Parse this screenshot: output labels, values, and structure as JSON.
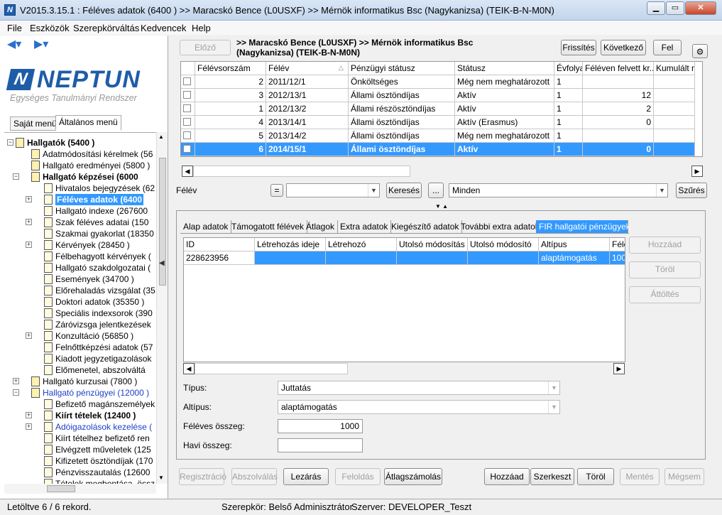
{
  "window": {
    "title": "V2015.3.15.1 : Féléves adatok (6400  )  >> Maracskó Bence (L0USXF) >> Mérnök informatikus Bsc (Nagykanizsa) (TEIK-B-N-M0N)"
  },
  "menu": [
    "File",
    "Eszközök",
    "Szerepkörváltás",
    "Kedvencek",
    "Help"
  ],
  "logo": {
    "name": "NEPTUN",
    "tagline": "Egységes Tanulmányi Rendszer"
  },
  "left_tabs": [
    "Saját menü",
    "Általános menü"
  ],
  "tree": [
    {
      "label": "Hallgatók (5400  )",
      "level": 0,
      "bold": true,
      "pm": "-"
    },
    {
      "label": "Adatmódosítási kérelmek (56",
      "level": 1
    },
    {
      "label": "Hallgató eredményei (5800  )",
      "level": 1
    },
    {
      "label": "Hallgató képzései (6000",
      "level": 1,
      "bold": true,
      "pm": "-"
    },
    {
      "label": "Hivatalos bejegyzések (62",
      "level": 2
    },
    {
      "label": "Féléves adatok (6400",
      "level": 2,
      "sel": true,
      "pm": "+"
    },
    {
      "label": "Hallgató indexe (267600",
      "level": 2
    },
    {
      "label": "Szak féléves adatai (150",
      "level": 2,
      "pm": "+"
    },
    {
      "label": "Szakmai gyakorlat (18350",
      "level": 2
    },
    {
      "label": "Kérvények (28450  )",
      "level": 2,
      "pm": "+"
    },
    {
      "label": "Félbehagyott kérvények (",
      "level": 2
    },
    {
      "label": "Hallgató szakdolgozatai (",
      "level": 2
    },
    {
      "label": "Események (34700  )",
      "level": 2
    },
    {
      "label": "Előrehaladás vizsgálat (35",
      "level": 2
    },
    {
      "label": "Doktori adatok (35350  )",
      "level": 2
    },
    {
      "label": "Speciális indexsorok (390",
      "level": 2
    },
    {
      "label": "Záróvizsga jelentkezések",
      "level": 2
    },
    {
      "label": "Konzultáció (56850  )",
      "level": 2,
      "pm": "+"
    },
    {
      "label": "Felnőttképzési adatok (57",
      "level": 2
    },
    {
      "label": "Kiadott jegyzetigazolások",
      "level": 2
    },
    {
      "label": "Előmenetel, abszolváltá",
      "level": 2
    },
    {
      "label": "Hallgató kurzusai (7800  )",
      "level": 1,
      "pm": "+"
    },
    {
      "label": "Hallgató pénzügyei (12000  )",
      "level": 1,
      "blue": true,
      "pm": "-"
    },
    {
      "label": "Befizető magánszemélyek",
      "level": 2
    },
    {
      "label": "Kiírt tételek (12400  )",
      "level": 2,
      "bold": true,
      "pm": "+"
    },
    {
      "label": "Adóigazolások kezelése (",
      "level": 2,
      "blue": true,
      "pm": "+"
    },
    {
      "label": "Kiírt tételhez befizető ren",
      "level": 2
    },
    {
      "label": "Elvégzett műveletek (125",
      "level": 2
    },
    {
      "label": "Kifizetett ösztöndíjak (170",
      "level": 2
    },
    {
      "label": "Pénzvisszautalás (12600",
      "level": 2
    },
    {
      "label": "Tételek megbontása, össz",
      "level": 2
    }
  ],
  "top_buttons": {
    "prev": "Előző",
    "refresh": "Frissítés",
    "next": "Következő",
    "up": "Fel"
  },
  "breadcrumb": ">> Maracskó Bence (L0USXF) >> Mérnök informatikus Bsc\n(Nagykanizsa) (TEIK-B-N-M0N)",
  "semester_grid": {
    "columns": [
      "Félévsorszám",
      "Félév",
      "Pénzügyi státusz",
      "Státusz",
      "Évfolyam",
      "Féléven felvett kr...",
      "Kumulált me"
    ],
    "rows": [
      [
        "2",
        "2011/12/1",
        "Önköltséges",
        "Még nem meghatározott",
        "1",
        "",
        ""
      ],
      [
        "3",
        "2012/13/1",
        "Állami ösztöndíjas",
        "Aktív",
        "1",
        "12",
        ""
      ],
      [
        "1",
        "2012/13/2",
        "Állami részösztöndíjas",
        "Aktív",
        "1",
        "2",
        ""
      ],
      [
        "4",
        "2013/14/1",
        "Állami ösztöndíjas",
        "Aktív (Erasmus)",
        "1",
        "0",
        ""
      ],
      [
        "5",
        "2013/14/2",
        "Állami ösztöndíjas",
        "Még nem meghatározott",
        "1",
        "",
        ""
      ],
      [
        "6",
        "2014/15/1",
        "Állami ösztöndíjas",
        "Aktív",
        "1",
        "0",
        ""
      ]
    ],
    "selected_row": 5
  },
  "filter": {
    "label": "Félév",
    "op": "=",
    "value": "",
    "search": "Keresés",
    "more": "...",
    "scope": "Minden",
    "filter_btn": "Szűrés"
  },
  "detail_tabs": [
    "Alap adatok",
    "Támogatott félévek",
    "Átlagok",
    "Extra adatok",
    "Kiegészítő adatok",
    "További extra adatok",
    "FIR hallgatói pénzügyek"
  ],
  "fir_grid": {
    "columns": [
      "ID",
      "Létrehozás ideje",
      "Létrehozó",
      "Utolsó módosítás ...",
      "Utolsó módosító",
      "Altípus",
      "Félé"
    ],
    "rows": [
      [
        "228623956",
        "",
        "",
        "",
        "",
        "alaptámogatás",
        "100"
      ]
    ]
  },
  "side_buttons": {
    "add": "Hozzáad",
    "delete": "Töröl",
    "move": "Áttöltés"
  },
  "form": {
    "type_label": "Típus:",
    "type_value": "Juttatás",
    "subtype_label": "Altípus:",
    "subtype_value": "alaptámogatás",
    "sem_amount_label": "Féléves összeg:",
    "sem_amount_value": "1000",
    "monthly_label": "Havi összeg:",
    "monthly_value": ""
  },
  "bottom_buttons": {
    "register": "Regisztráció",
    "absolve": "Abszolválás",
    "close": "Lezárás",
    "unlock": "Feloldás",
    "avg": "Átlagszámolás",
    "add": "Hozzáad",
    "edit": "Szerkeszt",
    "delete": "Töröl",
    "save": "Mentés",
    "cancel": "Mégsem"
  },
  "status": {
    "records": "Letöltve 6 / 6 rekord.",
    "role": "Szerepkör: Belső Adminisztrátor",
    "server": "Szerver: DEVELOPER_Teszt"
  }
}
